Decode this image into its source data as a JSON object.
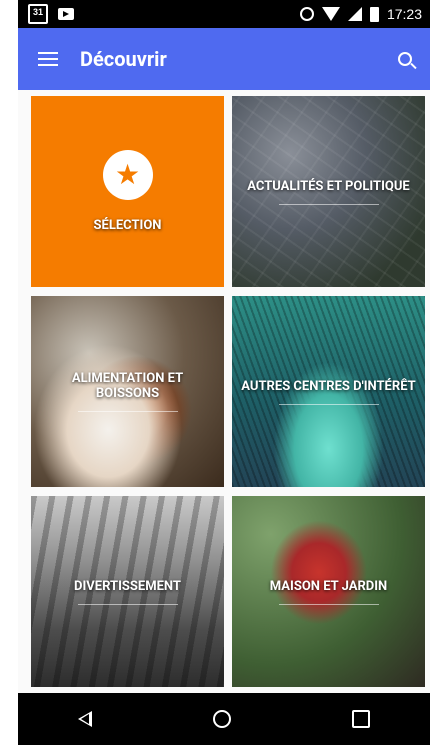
{
  "status_bar": {
    "calendar_date": "31",
    "time": "17:23",
    "icons": [
      "calendar-icon",
      "video-icon",
      "alarm-icon",
      "wifi-icon",
      "signal-icon",
      "battery-icon"
    ]
  },
  "app_bar": {
    "title": "Découvrir",
    "menu_icon": "menu-icon",
    "search_icon": "search-icon",
    "color": "#4f6af0"
  },
  "tiles": [
    {
      "label": "SÉLECTION",
      "icon": "star-icon",
      "color": "#f57c00"
    },
    {
      "label": "ACTUALITÉS ET POLITIQUE"
    },
    {
      "label": "ALIMENTATION ET BOISSONS"
    },
    {
      "label": "AUTRES CENTRES D'INTÉRÊT"
    },
    {
      "label": "DIVERTISSEMENT"
    },
    {
      "label": "MAISON ET JARDIN"
    }
  ],
  "nav_bar": {
    "icons": [
      "back-icon",
      "home-icon",
      "recent-apps-icon"
    ]
  }
}
